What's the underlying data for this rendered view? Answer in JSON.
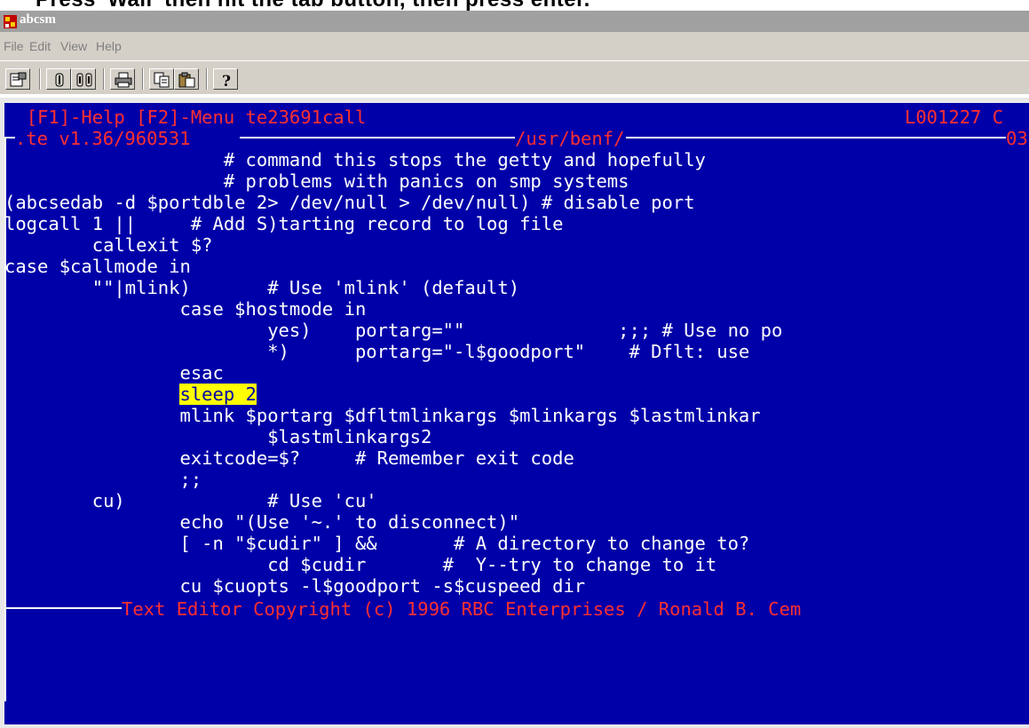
{
  "top_strip": {
    "text": "Press 'Wall' then hit the tab button, then press enter."
  },
  "window": {
    "title": "abcsm"
  },
  "menu": {
    "items": [
      "File",
      "Edit",
      "View",
      "Help"
    ]
  },
  "toolbar": {
    "buttons": [
      "properties-icon",
      "connect-icon",
      "disconnect-icon",
      "print-icon",
      "copy-icon",
      "paste-icon",
      "help-icon"
    ]
  },
  "terminal": {
    "colors": {
      "background": "#0000a8",
      "text": "#ffffff",
      "status": "#ff3030",
      "highlight": "#ffff00"
    },
    "header": {
      "help": "[F1]-Help",
      "menu": "[F2]-Menu",
      "filename": "te23691call",
      "position": "L001227 C"
    },
    "titleline": {
      "version": ".te v1.36/960531",
      "path": "/usr/benf/",
      "right": "03"
    },
    "code_lines": [
      "                    # command this stops the getty and hopefully",
      "                    # problems with panics on smp systems",
      "(abcsedab -d $portdble 2> /dev/null > /dev/null) # disable port",
      "logcall 1 ||     # Add S)tarting record to log file",
      "        callexit $?",
      "case $callmode in",
      "        \"\"|mlink)       # Use 'mlink' (default)",
      "                case $hostmode in",
      "                        yes)    portarg=\"\"              ;;; # Use no po",
      "                        *)      portarg=\"-l$goodport\"    # Dflt: use",
      "                esac",
      "                sleep 2",
      "                mlink $portarg $dfltmlinkargs $mlinkargs $lastmlinkar",
      "                        $lastmlinkargs2",
      "                exitcode=$?     # Remember exit code",
      "                ;;",
      "        cu)             # Use 'cu'",
      "                echo \"(Use '~.' to disconnect)\"",
      "                [ -n \"$cudir\" ] &&       # A directory to change to?",
      "                        cd $cudir       #  Y--try to change to it",
      "                cu $cuopts -l$goodport -s$cuspeed dir"
    ],
    "cursor_line": {
      "indent": "                ",
      "highlighted": "sleep 2"
    },
    "footer": "Text Editor Copyright (c) 1996 RBC Enterprises / Ronald B. Cem"
  }
}
